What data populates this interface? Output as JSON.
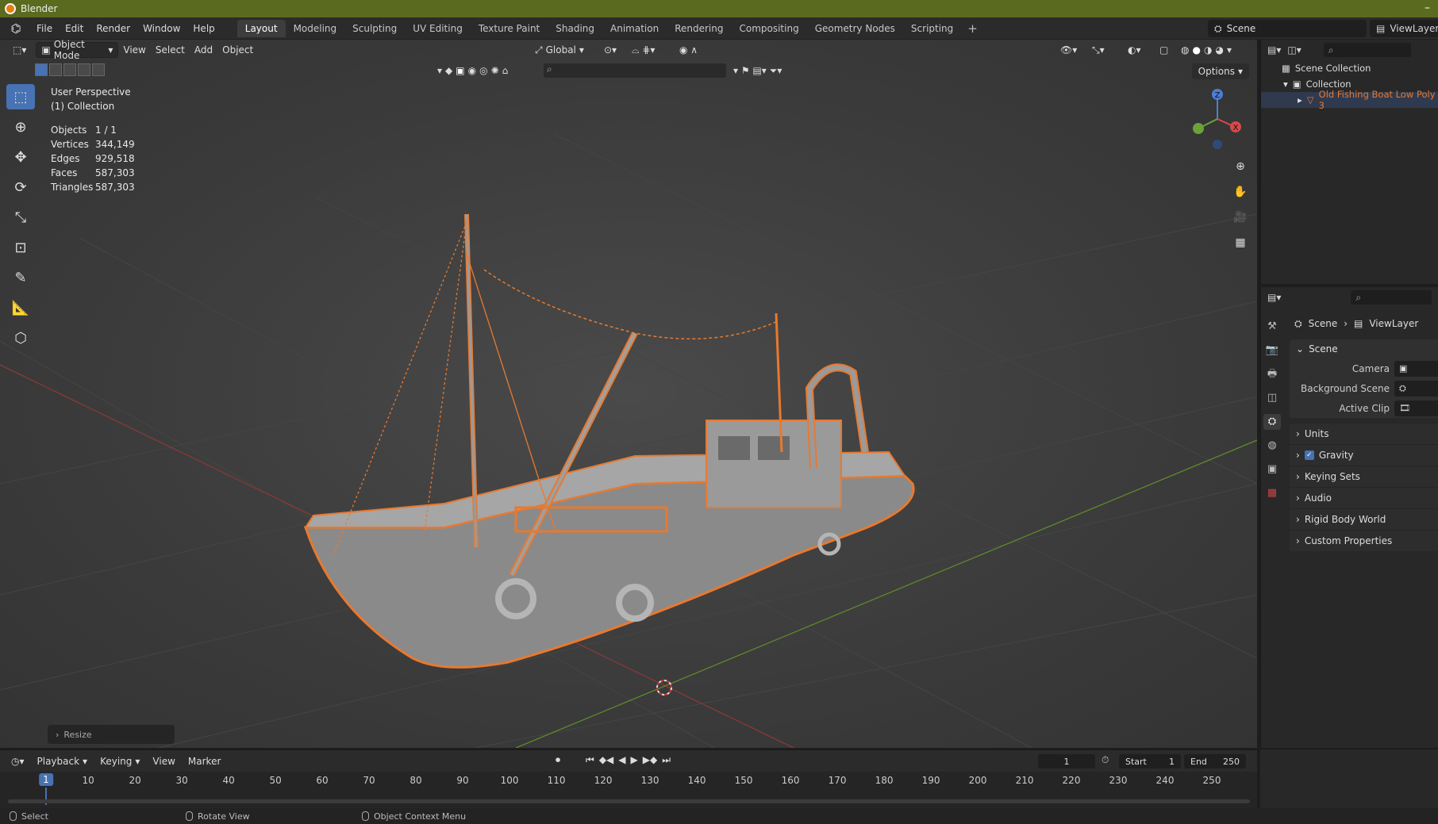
{
  "app": {
    "title": "Blender"
  },
  "menu": [
    "File",
    "Edit",
    "Render",
    "Window",
    "Help"
  ],
  "workspaces": [
    "Layout",
    "Modeling",
    "Sculpting",
    "UV Editing",
    "Texture Paint",
    "Shading",
    "Animation",
    "Rendering",
    "Compositing",
    "Geometry Nodes",
    "Scripting"
  ],
  "active_workspace": "Layout",
  "scene_name": "Scene",
  "view_layer_name": "ViewLayer",
  "viewport": {
    "mode": "Object Mode",
    "menus": [
      "View",
      "Select",
      "Add",
      "Object"
    ],
    "orientation": "Global",
    "options_label": "Options",
    "view_name": "User Perspective",
    "collection": "(1) Collection",
    "stats": [
      {
        "k": "Objects",
        "v": "1 / 1"
      },
      {
        "k": "Vertices",
        "v": "344,149"
      },
      {
        "k": "Edges",
        "v": "929,518"
      },
      {
        "k": "Faces",
        "v": "587,303"
      },
      {
        "k": "Triangles",
        "v": "587,303"
      }
    ],
    "last_op": "Resize",
    "gizmo": {
      "z": "Z",
      "x": "X"
    }
  },
  "outliner": {
    "scene_collection": "Scene Collection",
    "collection": "Collection",
    "object": "Old Fishing Boat Low Poly 3"
  },
  "properties": {
    "breadcrumb_scene": "Scene",
    "breadcrumb_viewlayer": "ViewLayer",
    "panel_title": "Scene",
    "fields": {
      "camera": "Camera",
      "background_scene": "Background Scene",
      "active_clip": "Active Clip"
    },
    "collapsed": [
      "Units",
      "Gravity",
      "Keying Sets",
      "Audio",
      "Rigid Body World",
      "Custom Properties"
    ]
  },
  "timeline": {
    "menus": [
      "Playback",
      "Keying",
      "View",
      "Marker"
    ],
    "current_frame": "1",
    "start_label": "Start",
    "start": "1",
    "end_label": "End",
    "end": "250",
    "ticks": [
      "10",
      "20",
      "30",
      "40",
      "50",
      "60",
      "70",
      "80",
      "90",
      "100",
      "110",
      "120",
      "130",
      "140",
      "150",
      "160",
      "170",
      "180",
      "190",
      "200",
      "210",
      "220",
      "230",
      "240",
      "250"
    ]
  },
  "status": [
    "Select",
    "Rotate View",
    "Object Context Menu"
  ],
  "colors": {
    "accent": "#4772b3",
    "selection": "#e8792f",
    "titlebar": "#5a6a1e"
  }
}
